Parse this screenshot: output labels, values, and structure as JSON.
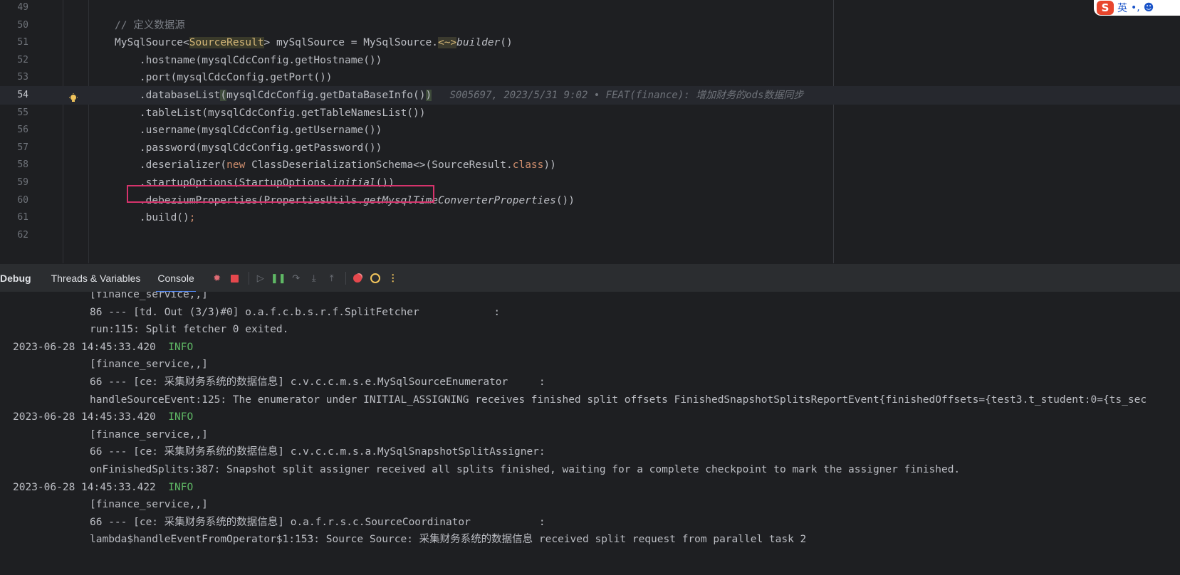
{
  "editor": {
    "line_numbers": [
      "49",
      "50",
      "51",
      "52",
      "53",
      "54",
      "55",
      "56",
      "57",
      "58",
      "59",
      "60",
      "61",
      "62"
    ],
    "lines": [
      {
        "no": "49",
        "parts": []
      },
      {
        "no": "50",
        "parts": [
          {
            "t": "// 定义数据源",
            "c": "tok-comment"
          }
        ]
      },
      {
        "no": "51",
        "parts": [
          {
            "t": "MySqlSource<",
            "c": ""
          },
          {
            "t": "SourceResult",
            "c": "tok-param"
          },
          {
            "t": "> mySqlSource = MySqlSource.",
            "c": ""
          },
          {
            "t": "<~>",
            "c": "tok-fold"
          },
          {
            "t": "builder",
            "c": "tok-italic"
          },
          {
            "t": "()",
            "c": ""
          }
        ]
      },
      {
        "no": "52",
        "parts": [
          {
            "t": "    .hostname(mysqlCdcConfig.getHostname())",
            "c": ""
          }
        ]
      },
      {
        "no": "53",
        "parts": [
          {
            "t": "    .port(mysqlCdcConfig.getPort())",
            "c": ""
          }
        ]
      },
      {
        "no": "54",
        "parts": [
          {
            "t": "    .databaseList",
            "c": ""
          },
          {
            "t": "(",
            "c": "tok-hl"
          },
          {
            "t": "mysqlCdcConfig.getDataBaseInfo()",
            "c": ""
          },
          {
            "t": ")",
            "c": "tok-hl"
          }
        ]
      },
      {
        "no": "55",
        "parts": [
          {
            "t": "    .tableList(mysqlCdcConfig.getTableNamesList())",
            "c": ""
          }
        ]
      },
      {
        "no": "56",
        "parts": [
          {
            "t": "    .username(mysqlCdcConfig.getUsername())",
            "c": ""
          }
        ]
      },
      {
        "no": "57",
        "parts": [
          {
            "t": "    .password(mysqlCdcConfig.getPassword())",
            "c": ""
          }
        ]
      },
      {
        "no": "58",
        "parts": [
          {
            "t": "    .deserializer(",
            "c": ""
          },
          {
            "t": "new",
            "c": "tok-kw"
          },
          {
            "t": " ClassDeserializationSchema<>(SourceResult.",
            "c": ""
          },
          {
            "t": "class",
            "c": "tok-kw"
          },
          {
            "t": "))",
            "c": ""
          }
        ]
      },
      {
        "no": "59",
        "parts": [
          {
            "t": "    .startupOptions(StartupOptions.",
            "c": ""
          },
          {
            "t": "initial",
            "c": "tok-italic"
          },
          {
            "t": "())",
            "c": ""
          }
        ]
      },
      {
        "no": "60",
        "parts": [
          {
            "t": "    .debeziumProperties(PropertiesUtils.",
            "c": ""
          },
          {
            "t": "getMysqlTimeConverterProperties",
            "c": "tok-italic"
          },
          {
            "t": "())",
            "c": ""
          }
        ]
      },
      {
        "no": "61",
        "parts": [
          {
            "t": "    .build()",
            "c": ""
          },
          {
            "t": ";",
            "c": "tok-kw"
          }
        ]
      },
      {
        "no": "62",
        "parts": []
      }
    ],
    "blame": "S005697, 2023/5/31 9:02 • FEAT(finance): 增加财务的ods数据同步",
    "current_line": "54"
  },
  "ime": {
    "logo": "S",
    "lang": "英",
    "punct": "•,",
    "emoji": "☻"
  },
  "debug_toolbar": {
    "title": "Debug",
    "tabs": [
      {
        "label": "Threads & Variables",
        "active": false
      },
      {
        "label": "Console",
        "active": true
      }
    ],
    "icons": [
      "rerun-debug-icon",
      "stop-icon",
      "resume-icon",
      "pause-icon",
      "step-over-icon",
      "step-into-icon",
      "step-out-icon",
      "view-breakpoints-icon",
      "mute-breakpoints-icon",
      "more-icon"
    ]
  },
  "console": {
    "lines": [
      {
        "kind": "ind",
        "text": "[finance_service,,]"
      },
      {
        "kind": "ind",
        "text": "86 --- [td. Out (3/3)#0] o.a.f.c.b.s.r.f.SplitFetcher            :"
      },
      {
        "kind": "ind",
        "text": "run:115: Split fetcher 0 exited."
      },
      {
        "kind": "ts",
        "text": "2023-06-28 14:45:33.420",
        "level": "INFO"
      },
      {
        "kind": "ind",
        "text": "[finance_service,,]"
      },
      {
        "kind": "ind",
        "text": "66 --- [ce: 采集财务系统的数据信息] c.v.c.c.m.s.e.MySqlSourceEnumerator     :"
      },
      {
        "kind": "ind",
        "text": "handleSourceEvent:125: The enumerator under INITIAL_ASSIGNING receives finished split offsets FinishedSnapshotSplitsReportEvent{finishedOffsets={test3.t_student:0={ts_sec"
      },
      {
        "kind": "ts",
        "text": "2023-06-28 14:45:33.420",
        "level": "INFO"
      },
      {
        "kind": "ind",
        "text": "[finance_service,,]"
      },
      {
        "kind": "ind",
        "text": "66 --- [ce: 采集财务系统的数据信息] c.v.c.c.m.s.a.MySqlSnapshotSplitAssigner:"
      },
      {
        "kind": "ind",
        "text": "onFinishedSplits:387: Snapshot split assigner received all splits finished, waiting for a complete checkpoint to mark the assigner finished."
      },
      {
        "kind": "ts",
        "text": "2023-06-28 14:45:33.422",
        "level": "INFO"
      },
      {
        "kind": "ind",
        "text": "[finance_service,,]"
      },
      {
        "kind": "ind",
        "text": "66 --- [ce: 采集财务系统的数据信息] o.a.f.r.s.c.SourceCoordinator           :"
      },
      {
        "kind": "ind",
        "text": "lambda$handleEventFromOperator$1:153: Source Source: 采集财务系统的数据信息 received split request from parallel task 2"
      }
    ]
  }
}
